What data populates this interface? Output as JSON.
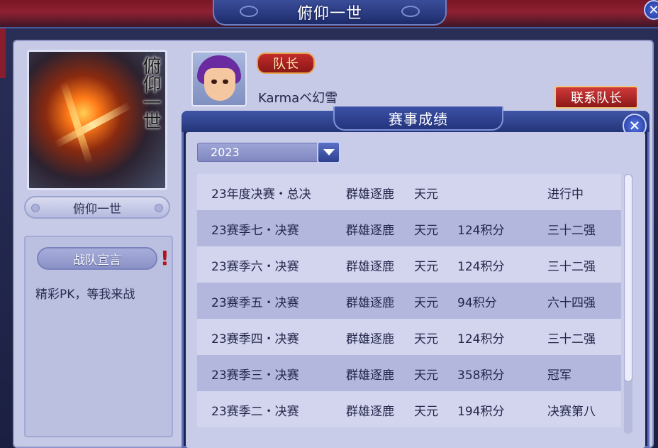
{
  "window": {
    "title": "俯仰一世"
  },
  "team": {
    "portrait_calligraphy": "俯仰一世",
    "name": "俯仰一世",
    "manifesto_label": "战队宣言",
    "manifesto_text": "精彩PK，等我来战"
  },
  "captain": {
    "badge": "队长",
    "name": "Karmaベ幻雪",
    "contact_button": "联系队长"
  },
  "results_popup": {
    "title": "赛事成绩",
    "selected_year": "2023",
    "rows": [
      {
        "event": "23年度决赛・总决",
        "division": "群雄逐鹿",
        "server": "天元",
        "points": "",
        "result": "进行中"
      },
      {
        "event": "23赛季七・决赛",
        "division": "群雄逐鹿",
        "server": "天元",
        "points": "124积分",
        "result": "三十二强"
      },
      {
        "event": "23赛季六・决赛",
        "division": "群雄逐鹿",
        "server": "天元",
        "points": "124积分",
        "result": "三十二强"
      },
      {
        "event": "23赛季五・决赛",
        "division": "群雄逐鹿",
        "server": "天元",
        "points": "94积分",
        "result": "六十四强"
      },
      {
        "event": "23赛季四・决赛",
        "division": "群雄逐鹿",
        "server": "天元",
        "points": "124积分",
        "result": "三十二强"
      },
      {
        "event": "23赛季三・决赛",
        "division": "群雄逐鹿",
        "server": "天元",
        "points": "358积分",
        "result": "冠军"
      },
      {
        "event": "23赛季二・决赛",
        "division": "群雄逐鹿",
        "server": "天元",
        "points": "194积分",
        "result": "决赛第八"
      }
    ],
    "scroll_fraction_visible": 0.8
  },
  "icons": {
    "close": "close-icon",
    "dropdown": "chevron-down-icon",
    "alert": "exclamation-icon"
  },
  "colors": {
    "accent_red": "#b3141c",
    "panel_bg": "#c7cae6",
    "frame_blue": "#243478"
  }
}
